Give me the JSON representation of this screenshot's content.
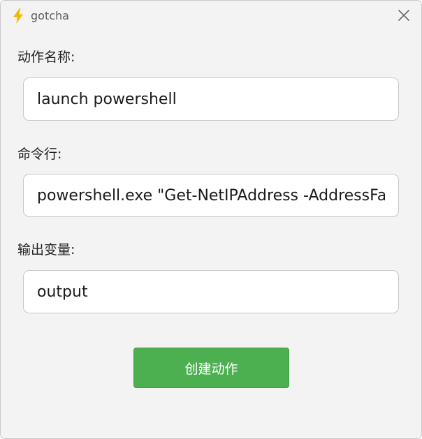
{
  "window": {
    "title": "gotcha",
    "title_icon": "lightning-bolt-icon",
    "close_icon": "close-icon",
    "colors": {
      "bolt": "#f2b800",
      "button": "#4caf50",
      "background": "#f3f3f3"
    }
  },
  "form": {
    "action_name": {
      "label": "动作名称:",
      "value": "launch powershell"
    },
    "command_line": {
      "label": "命令行:",
      "value": "powershell.exe \"Get-NetIPAddress -AddressFam"
    },
    "output_variable": {
      "label": "输出变量:",
      "value": "output"
    },
    "submit_label": "创建动作"
  }
}
